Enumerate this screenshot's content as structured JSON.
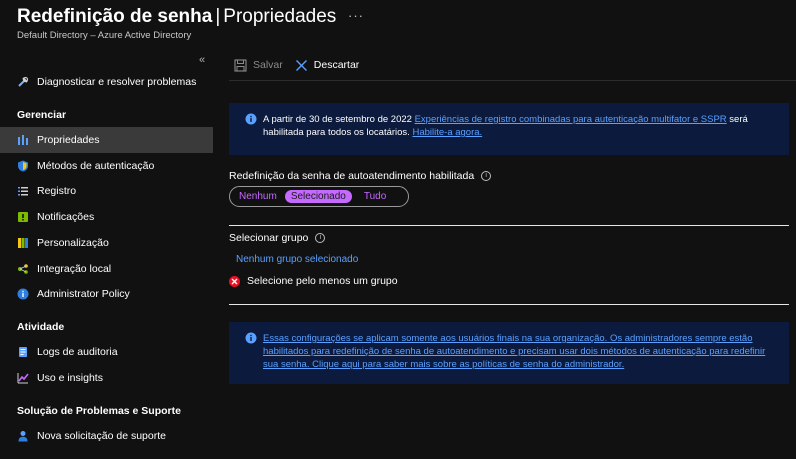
{
  "header": {
    "title": "Redefinição de senha",
    "separator": "|",
    "page": "Propriedades",
    "more": "···",
    "subtitle": "Default Directory – Azure Active Directory"
  },
  "sidebar": {
    "collapse": "«",
    "top_item": "Diagnosticar e resolver problemas",
    "sections": [
      {
        "title": "Gerenciar"
      },
      {
        "title": "Atividade"
      },
      {
        "title": "Solução de Problemas e Suporte"
      }
    ],
    "manage_items": [
      {
        "label": "Propriedades",
        "icon": "properties-icon",
        "active": true
      },
      {
        "label": "Métodos de autenticação",
        "icon": "shield-icon"
      },
      {
        "label": "Registro",
        "icon": "list-icon"
      },
      {
        "label": "Notificações",
        "icon": "notification-icon"
      },
      {
        "label": "Personalização",
        "icon": "palette-icon"
      },
      {
        "label": "Integração local",
        "icon": "sync-icon"
      },
      {
        "label": "Administrator Policy",
        "icon": "info-icon"
      }
    ],
    "activity_items": [
      {
        "label": "Logs de auditoria",
        "icon": "log-icon"
      },
      {
        "label": "Uso e insights",
        "icon": "chart-icon"
      }
    ],
    "support_items": [
      {
        "label": "Nova solicitação de suporte",
        "icon": "support-person-icon"
      }
    ]
  },
  "toolbar": {
    "save": "Salvar",
    "discard": "Descartar"
  },
  "banner1": {
    "prefix": "A partir de 30 de setembro de 2022 ",
    "link": "Experiências de registro combinadas para autenticação multifator e SSPR",
    "middle": " será habilitada para todos os locatários. ",
    "cta": "Habilite-a agora."
  },
  "sspr": {
    "label": "Redefinição da senha de autoatendimento habilitada",
    "options": [
      "Nenhum",
      "Selecionado",
      "Tudo"
    ],
    "selected": "Selecionado"
  },
  "group": {
    "label": "Selecionar grupo",
    "link": "Nenhum grupo selecionado",
    "error": "Selecione pelo menos um grupo"
  },
  "banner2": {
    "text": "Essas configurações se aplicam somente aos usuários finais na sua organização. Os administradores sempre estão habilitados para redefinição de senha de autoatendimento e precisam usar dois métodos de autenticação para redefinir sua senha. Clique aqui para saber mais sobre as políticas de senha do administrador."
  },
  "colors": {
    "background": "#111111",
    "accent_link": "#5aa0ff",
    "pill_selected": "#c569ff",
    "banner_bg": "#0b1a3d",
    "error": "#e81123"
  }
}
